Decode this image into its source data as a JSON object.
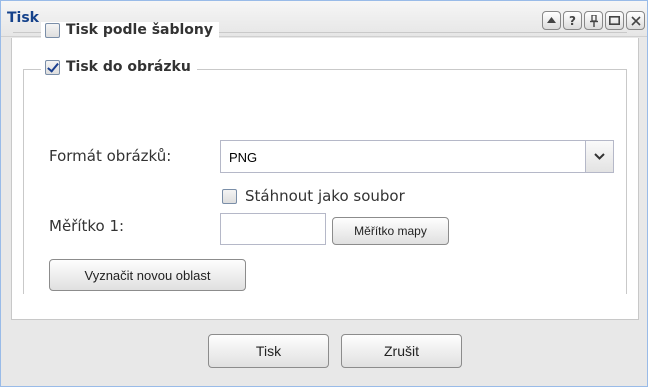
{
  "window": {
    "title": "Tisk",
    "tools": [
      "up-icon",
      "help-icon",
      "pin-icon",
      "maximize-icon",
      "close-icon"
    ]
  },
  "print_template": {
    "label": "Tisk podle šablony",
    "checked": false
  },
  "print_image": {
    "label": "Tisk do obrázku",
    "checked": true,
    "format_label": "Formát obrázků:",
    "format_value": "PNG",
    "download_label": "Stáhnout jako soubor",
    "download_checked": false,
    "scale_label": "Měřítko 1:",
    "scale_value": "",
    "map_scale_button": "Měřítko mapy",
    "new_area_button": "Vyznačit novou oblast"
  },
  "footer": {
    "print_button": "Tisk",
    "cancel_button": "Zrušit"
  },
  "colors": {
    "title": "#15428b",
    "checkmark": "#1a3f8f",
    "border": "#c9c9c9"
  }
}
